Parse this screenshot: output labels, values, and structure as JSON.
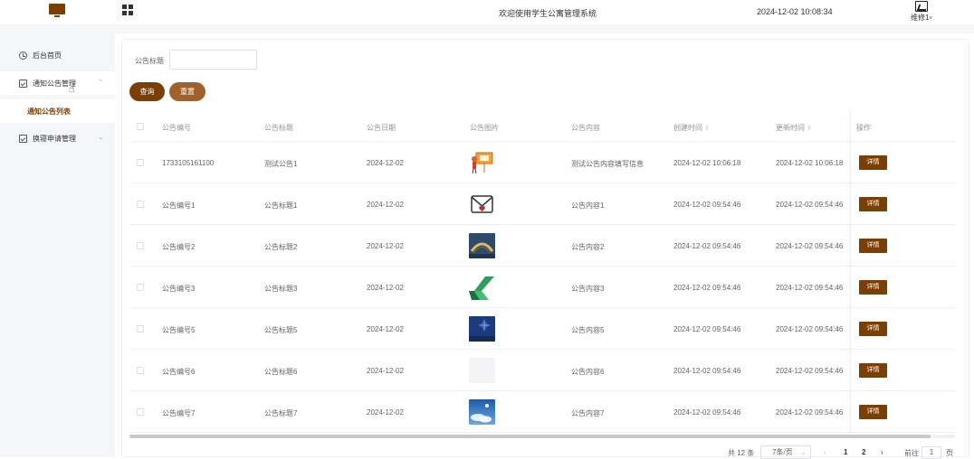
{
  "header": {
    "title": "欢迎使用学生公寓管理系统",
    "datetime": "2024-12-02 10:08:34",
    "username": "维修1"
  },
  "sidebar": {
    "items": [
      {
        "label": "后台首页",
        "icon": "clock-icon"
      },
      {
        "label": "通知公告管理",
        "icon": "notice-icon",
        "expanded": true,
        "children": [
          {
            "label": "通知公告列表"
          }
        ]
      },
      {
        "label": "换寝申请管理",
        "icon": "application-icon",
        "expanded": false
      }
    ]
  },
  "search": {
    "label": "公告标题",
    "value": "",
    "query_label": "查询",
    "reset_label": "重置"
  },
  "table": {
    "headers": [
      "公告编号",
      "公告标题",
      "公告日期",
      "公告图片",
      "公告内容",
      "创建时间",
      "更新时间",
      "操作"
    ],
    "detail_label": "详情",
    "rows": [
      {
        "id": "1733105161100",
        "title": "测试公告1",
        "date": "2024-12-02",
        "image": "presentation",
        "content": "测试公告内容填写信息",
        "created": "2024-12-02 10:06:18",
        "updated": "2024-12-02 10:06:18"
      },
      {
        "id": "公告编号1",
        "title": "公告标题1",
        "date": "2024-12-02",
        "image": "envelope",
        "content": "公告内容1",
        "created": "2024-12-02 09:54:46",
        "updated": "2024-12-02 09:54:46"
      },
      {
        "id": "公告编号2",
        "title": "公告标题2",
        "date": "2024-12-02",
        "image": "arch",
        "content": "公告内容2",
        "created": "2024-12-02 09:54:46",
        "updated": "2024-12-02 09:54:46"
      },
      {
        "id": "公告编号3",
        "title": "公告标题3",
        "date": "2024-12-02",
        "image": "green-shape",
        "content": "公告内容3",
        "created": "2024-12-02 09:54:46",
        "updated": "2024-12-02 09:54:46"
      },
      {
        "id": "公告编号5",
        "title": "公告标题5",
        "date": "2024-12-02",
        "image": "night-sky",
        "content": "公告内容5",
        "created": "2024-12-02 09:54:46",
        "updated": "2024-12-02 09:54:46"
      },
      {
        "id": "公告编号6",
        "title": "公告标题6",
        "date": "2024-12-02",
        "image": "blank",
        "content": "公告内容6",
        "created": "2024-12-02 09:54:46",
        "updated": "2024-12-02 09:54:46"
      },
      {
        "id": "公告编号7",
        "title": "公告标题7",
        "date": "2024-12-02",
        "image": "blue-sky",
        "content": "公告内容7",
        "created": "2024-12-02 09:54:46",
        "updated": "2024-12-02 09:54:46"
      }
    ]
  },
  "pagination": {
    "total": "共 12 条",
    "page_size": "7条/页",
    "pages": [
      "1",
      "2"
    ],
    "current_page": "1",
    "goto_label": "前往",
    "goto_value": "1",
    "page_unit": "页"
  },
  "colors": {
    "primary": "#7b3f05",
    "reset": "#a0622a",
    "sidebar_bg": "#f4f6f9"
  }
}
